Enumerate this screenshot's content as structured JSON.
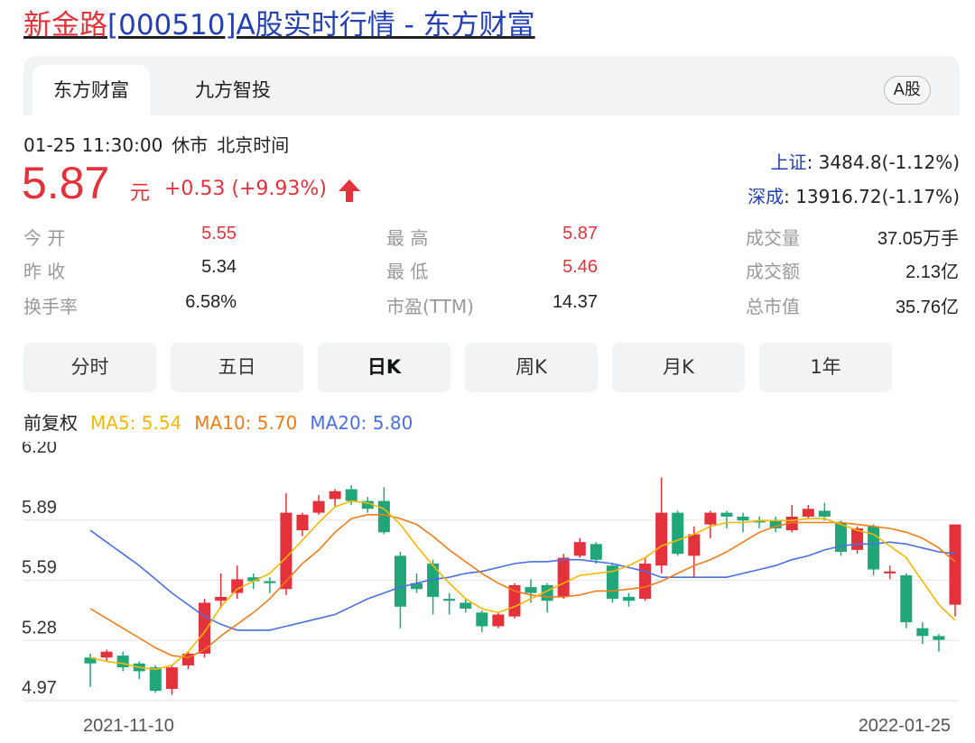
{
  "page": {
    "title_stock": "新金路",
    "title_rest": "[000510]A股实时行情 - 东方财富"
  },
  "tabs": [
    {
      "label": "东方财富",
      "active": true
    },
    {
      "label": "九方智投",
      "active": false
    }
  ],
  "market_tag": "A股",
  "quote": {
    "time": "01-25 11:30:00",
    "status": "休市",
    "timezone": "北京时间",
    "price": "5.87",
    "unit": "元",
    "change": "+0.53 (+9.93%)",
    "direction": "up"
  },
  "indices": [
    {
      "name": "上证",
      "value": ": 3484.8(-1.12%)"
    },
    {
      "name": "深成",
      "value": ": 13916.72(-1.17%)"
    }
  ],
  "stats": {
    "open": {
      "label": "今  开",
      "value": "5.55"
    },
    "prev_close": {
      "label": "昨  收",
      "value": "5.34"
    },
    "turnover_rate": {
      "label": "换手率",
      "value": "6.58%"
    },
    "high": {
      "label": "最  高",
      "value": "5.87"
    },
    "low": {
      "label": "最  低",
      "value": "5.46"
    },
    "pe": {
      "label": "市盈(TTM)",
      "value": "14.37"
    },
    "volume": {
      "label": "成交量",
      "value": "37.05万手"
    },
    "amount": {
      "label": "成交额",
      "value": "2.13亿"
    },
    "market_cap": {
      "label": "总市值",
      "value": "35.76亿"
    }
  },
  "periods": [
    {
      "label": "分时",
      "active": false
    },
    {
      "label": "五日",
      "active": false
    },
    {
      "label": "日K",
      "active": true
    },
    {
      "label": "周K",
      "active": false
    },
    {
      "label": "月K",
      "active": false
    },
    {
      "label": "1年",
      "active": false
    }
  ],
  "adjust_label": "前复权",
  "ma_legend": [
    {
      "label": "MA5: 5.54",
      "color": "#f5b800"
    },
    {
      "label": "MA10: 5.70",
      "color": "#f07c1a"
    },
    {
      "label": "MA20: 5.80",
      "color": "#4a6fe0"
    }
  ],
  "colors": {
    "up": "#e3323b",
    "down": "#21a67a",
    "accent_blue": "#2440b3"
  },
  "chart_data": {
    "type": "candlestick",
    "y_ticks": [
      "6.20",
      "5.89",
      "5.59",
      "5.28",
      "4.97"
    ],
    "ylim": [
      4.97,
      6.2
    ],
    "x_start_label": "2021-11-10",
    "x_end_label": "2022-01-25",
    "grid": true,
    "candles": [
      {
        "o": 5.19,
        "c": 5.16,
        "h": 5.21,
        "l": 5.04
      },
      {
        "o": 5.19,
        "c": 5.22,
        "h": 5.23,
        "l": 5.17
      },
      {
        "o": 5.2,
        "c": 5.14,
        "h": 5.22,
        "l": 5.12
      },
      {
        "o": 5.16,
        "c": 5.12,
        "h": 5.17,
        "l": 5.08
      },
      {
        "o": 5.14,
        "c": 5.02,
        "h": 5.15,
        "l": 5.01
      },
      {
        "o": 5.03,
        "c": 5.14,
        "h": 5.15,
        "l": 5.0
      },
      {
        "o": 5.15,
        "c": 5.21,
        "h": 5.22,
        "l": 5.13
      },
      {
        "o": 5.21,
        "c": 5.47,
        "h": 5.49,
        "l": 5.19
      },
      {
        "o": 5.48,
        "c": 5.5,
        "h": 5.62,
        "l": 5.44
      },
      {
        "o": 5.52,
        "c": 5.59,
        "h": 5.66,
        "l": 5.49
      },
      {
        "o": 5.6,
        "c": 5.58,
        "h": 5.62,
        "l": 5.54
      },
      {
        "o": 5.58,
        "c": 5.57,
        "h": 5.6,
        "l": 5.52
      },
      {
        "o": 5.54,
        "c": 5.93,
        "h": 6.03,
        "l": 5.51
      },
      {
        "o": 5.84,
        "c": 5.92,
        "h": 5.93,
        "l": 5.81
      },
      {
        "o": 5.93,
        "c": 5.99,
        "h": 6.02,
        "l": 5.92
      },
      {
        "o": 6.0,
        "c": 6.04,
        "h": 6.05,
        "l": 5.96
      },
      {
        "o": 6.05,
        "c": 5.99,
        "h": 6.07,
        "l": 5.97
      },
      {
        "o": 5.99,
        "c": 5.95,
        "h": 6.01,
        "l": 5.93
      },
      {
        "o": 5.99,
        "c": 5.83,
        "h": 6.06,
        "l": 5.82
      },
      {
        "o": 5.71,
        "c": 5.45,
        "h": 5.73,
        "l": 5.34
      },
      {
        "o": 5.57,
        "c": 5.54,
        "h": 5.62,
        "l": 5.52
      },
      {
        "o": 5.67,
        "c": 5.5,
        "h": 5.69,
        "l": 5.41
      },
      {
        "o": 5.49,
        "c": 5.48,
        "h": 5.52,
        "l": 5.41
      },
      {
        "o": 5.47,
        "c": 5.44,
        "h": 5.49,
        "l": 5.42
      },
      {
        "o": 5.42,
        "c": 5.35,
        "h": 5.43,
        "l": 5.32
      },
      {
        "o": 5.35,
        "c": 5.41,
        "h": 5.42,
        "l": 5.34
      },
      {
        "o": 5.4,
        "c": 5.56,
        "h": 5.57,
        "l": 5.39
      },
      {
        "o": 5.55,
        "c": 5.52,
        "h": 5.59,
        "l": 5.47
      },
      {
        "o": 5.56,
        "c": 5.48,
        "h": 5.57,
        "l": 5.42
      },
      {
        "o": 5.5,
        "c": 5.7,
        "h": 5.72,
        "l": 5.49
      },
      {
        "o": 5.71,
        "c": 5.78,
        "h": 5.8,
        "l": 5.7
      },
      {
        "o": 5.77,
        "c": 5.69,
        "h": 5.78,
        "l": 5.67
      },
      {
        "o": 5.66,
        "c": 5.49,
        "h": 5.67,
        "l": 5.47
      },
      {
        "o": 5.5,
        "c": 5.48,
        "h": 5.52,
        "l": 5.45
      },
      {
        "o": 5.49,
        "c": 5.67,
        "h": 5.7,
        "l": 5.48
      },
      {
        "o": 5.66,
        "c": 5.93,
        "h": 6.11,
        "l": 5.62
      },
      {
        "o": 5.93,
        "c": 5.72,
        "h": 5.94,
        "l": 5.71
      },
      {
        "o": 5.71,
        "c": 5.82,
        "h": 5.86,
        "l": 5.6
      },
      {
        "o": 5.87,
        "c": 5.93,
        "h": 5.94,
        "l": 5.8
      },
      {
        "o": 5.93,
        "c": 5.91,
        "h": 5.94,
        "l": 5.85
      },
      {
        "o": 5.91,
        "c": 5.89,
        "h": 5.93,
        "l": 5.83
      },
      {
        "o": 5.89,
        "c": 5.88,
        "h": 5.91,
        "l": 5.85
      },
      {
        "o": 5.89,
        "c": 5.85,
        "h": 5.91,
        "l": 5.83
      },
      {
        "o": 5.84,
        "c": 5.91,
        "h": 5.97,
        "l": 5.83
      },
      {
        "o": 5.91,
        "c": 5.95,
        "h": 5.97,
        "l": 5.9
      },
      {
        "o": 5.94,
        "c": 5.91,
        "h": 5.98,
        "l": 5.89
      },
      {
        "o": 5.88,
        "c": 5.73,
        "h": 5.89,
        "l": 5.71
      },
      {
        "o": 5.74,
        "c": 5.85,
        "h": 5.86,
        "l": 5.72
      },
      {
        "o": 5.86,
        "c": 5.64,
        "h": 5.87,
        "l": 5.61
      },
      {
        "o": 5.62,
        "c": 5.63,
        "h": 5.66,
        "l": 5.59
      },
      {
        "o": 5.61,
        "c": 5.37,
        "h": 5.62,
        "l": 5.34
      },
      {
        "o": 5.34,
        "c": 5.3,
        "h": 5.37,
        "l": 5.26
      },
      {
        "o": 5.3,
        "c": 5.28,
        "h": 5.31,
        "l": 5.22
      },
      {
        "o": 5.46,
        "c": 5.87,
        "h": 5.87,
        "l": 5.4
      }
    ],
    "ma5": [
      5.19,
      5.17,
      5.16,
      5.14,
      5.13,
      5.15,
      5.22,
      5.32,
      5.45,
      5.54,
      5.58,
      5.62,
      5.7,
      5.79,
      5.88,
      5.96,
      5.99,
      5.98,
      5.95,
      5.87,
      5.76,
      5.66,
      5.57,
      5.49,
      5.44,
      5.42,
      5.45,
      5.49,
      5.53,
      5.57,
      5.61,
      5.62,
      5.63,
      5.66,
      5.7,
      5.76,
      5.79,
      5.82,
      5.86,
      5.88,
      5.88,
      5.89,
      5.89,
      5.89,
      5.9,
      5.9,
      5.87,
      5.84,
      5.82,
      5.76,
      5.7,
      5.58,
      5.46,
      5.38,
      5.43
    ],
    "ma10": [
      5.44,
      5.39,
      5.34,
      5.29,
      5.24,
      5.2,
      5.19,
      5.23,
      5.3,
      5.36,
      5.42,
      5.49,
      5.58,
      5.67,
      5.74,
      5.83,
      5.9,
      5.92,
      5.92,
      5.9,
      5.87,
      5.81,
      5.74,
      5.68,
      5.62,
      5.57,
      5.53,
      5.51,
      5.5,
      5.5,
      5.51,
      5.53,
      5.53,
      5.54,
      5.55,
      5.58,
      5.62,
      5.66,
      5.69,
      5.73,
      5.78,
      5.83,
      5.86,
      5.88,
      5.88,
      5.88,
      5.88,
      5.87,
      5.86,
      5.85,
      5.83,
      5.8,
      5.75,
      5.68,
      5.64,
      5.65
    ],
    "ma20": [
      5.84,
      5.78,
      5.72,
      5.66,
      5.59,
      5.52,
      5.46,
      5.4,
      5.36,
      5.33,
      5.33,
      5.33,
      5.35,
      5.37,
      5.39,
      5.41,
      5.45,
      5.49,
      5.52,
      5.55,
      5.57,
      5.59,
      5.6,
      5.62,
      5.63,
      5.65,
      5.67,
      5.68,
      5.68,
      5.69,
      5.69,
      5.68,
      5.67,
      5.65,
      5.63,
      5.6,
      5.6,
      5.6,
      5.6,
      5.6,
      5.62,
      5.64,
      5.66,
      5.69,
      5.71,
      5.74,
      5.76,
      5.77,
      5.77,
      5.78,
      5.77,
      5.75,
      5.73,
      5.72,
      5.73
    ]
  }
}
